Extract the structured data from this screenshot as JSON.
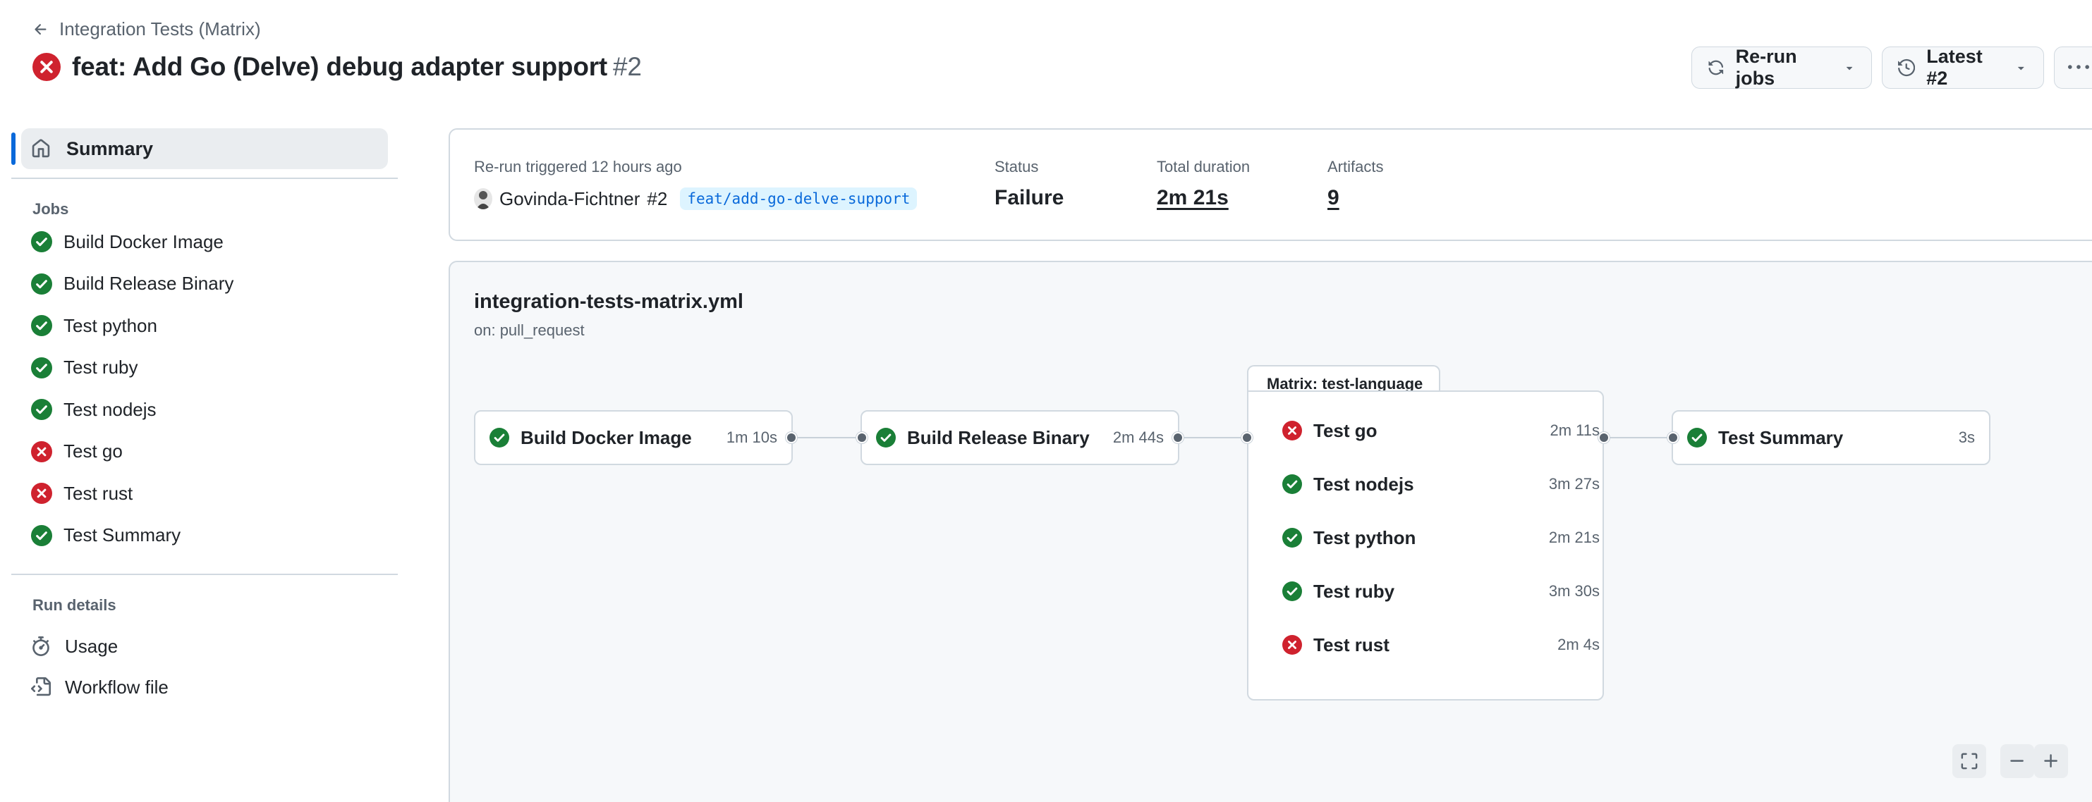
{
  "header": {
    "back_label": "Integration Tests (Matrix)",
    "title": "feat: Add Go (Delve) debug adapter support",
    "run_number": "#2",
    "rerun_label": "Re-run jobs",
    "latest_label": "Latest #2"
  },
  "sidebar": {
    "summary_label": "Summary",
    "jobs_heading": "Jobs",
    "jobs": [
      {
        "label": "Build Docker Image",
        "status": "success"
      },
      {
        "label": "Build Release Binary",
        "status": "success"
      },
      {
        "label": "Test python",
        "status": "success"
      },
      {
        "label": "Test ruby",
        "status": "success"
      },
      {
        "label": "Test nodejs",
        "status": "success"
      },
      {
        "label": "Test go",
        "status": "failure"
      },
      {
        "label": "Test rust",
        "status": "failure"
      },
      {
        "label": "Test Summary",
        "status": "success"
      }
    ],
    "run_details_heading": "Run details",
    "usage_label": "Usage",
    "workflow_file_label": "Workflow file"
  },
  "run_info": {
    "trigger": "Re-run triggered 12 hours ago",
    "actor": "Govinda-Fichtner",
    "actor_run": "#2",
    "branch": "feat/add-go-delve-support",
    "status_label": "Status",
    "status_value": "Failure",
    "duration_label": "Total duration",
    "duration_value": "2m 21s",
    "artifacts_label": "Artifacts",
    "artifacts_value": "9"
  },
  "workflow": {
    "file": "integration-tests-matrix.yml",
    "trigger": "on: pull_request",
    "build_docker": {
      "name": "Build Docker Image",
      "duration": "1m 10s",
      "status": "success"
    },
    "build_release": {
      "name": "Build Release Binary",
      "duration": "2m 44s",
      "status": "success"
    },
    "matrix_label": "Matrix: test-language",
    "matrix_jobs": [
      {
        "name": "Test go",
        "duration": "2m 11s",
        "status": "failure"
      },
      {
        "name": "Test nodejs",
        "duration": "3m 27s",
        "status": "success"
      },
      {
        "name": "Test python",
        "duration": "2m 21s",
        "status": "success"
      },
      {
        "name": "Test ruby",
        "duration": "3m 30s",
        "status": "success"
      },
      {
        "name": "Test rust",
        "duration": "2m 4s",
        "status": "failure"
      }
    ],
    "summary_job": {
      "name": "Test Summary",
      "duration": "3s",
      "status": "success"
    }
  },
  "colors": {
    "success": "#1a7f37",
    "failure": "#cf222e",
    "accent": "#0969da"
  },
  "icons": {
    "success": "check-circle-fill-icon",
    "failure": "x-circle-fill-icon"
  }
}
